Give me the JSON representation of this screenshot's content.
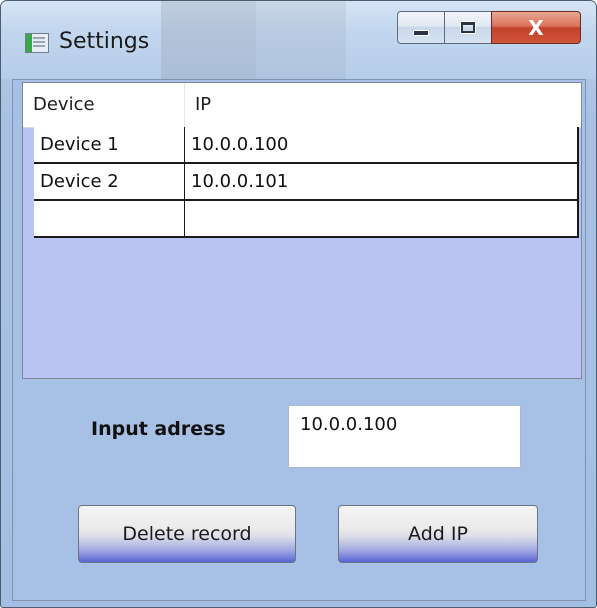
{
  "window": {
    "title": "Settings",
    "minimize_icon": "minimize-icon",
    "maximize_icon": "maximize-icon",
    "close_glyph": "X"
  },
  "grid": {
    "columns": [
      "Device",
      "IP"
    ],
    "rows": [
      {
        "device": "Device 1",
        "ip": "10.0.0.100"
      },
      {
        "device": "Device 2",
        "ip": "10.0.0.101"
      },
      {
        "device": "",
        "ip": ""
      }
    ]
  },
  "form": {
    "input_label": "Input adress",
    "input_value": "10.0.0.100"
  },
  "buttons": {
    "delete_label": "Delete record",
    "add_label": "Add IP"
  },
  "colors": {
    "client_background": "#a7c1e6",
    "grid_empty_area": "#b9c4f2",
    "close_button": "#c3412a"
  }
}
